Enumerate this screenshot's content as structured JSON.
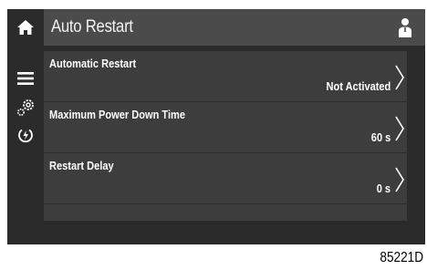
{
  "header": {
    "title": "Auto Restart"
  },
  "sidebar": {
    "items": [
      {
        "icon": "home-icon"
      },
      {
        "icon": "menu-icon"
      },
      {
        "icon": "settings-gear-icon"
      },
      {
        "icon": "power-icon"
      }
    ]
  },
  "settings": [
    {
      "label": "Automatic Restart",
      "value": "Not Activated"
    },
    {
      "label": "Maximum Power Down Time",
      "value": "60 s"
    },
    {
      "label": "Restart Delay",
      "value": "0 s"
    }
  ],
  "figure_id": "85221D",
  "colors": {
    "background": "#2b2b2b",
    "header": "#4b4b4b",
    "row": "#3d3d3d",
    "text": "#ffffff"
  }
}
